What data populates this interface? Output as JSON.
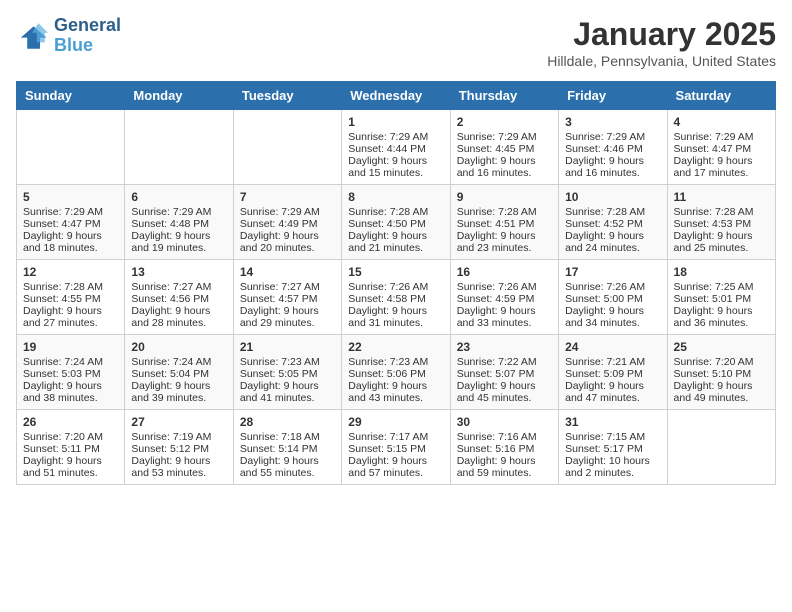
{
  "header": {
    "logo_line1": "General",
    "logo_line2": "Blue",
    "title": "January 2025",
    "subtitle": "Hilldale, Pennsylvania, United States"
  },
  "weekdays": [
    "Sunday",
    "Monday",
    "Tuesday",
    "Wednesday",
    "Thursday",
    "Friday",
    "Saturday"
  ],
  "weeks": [
    [
      {
        "day": "",
        "lines": []
      },
      {
        "day": "",
        "lines": []
      },
      {
        "day": "",
        "lines": []
      },
      {
        "day": "1",
        "lines": [
          "Sunrise: 7:29 AM",
          "Sunset: 4:44 PM",
          "Daylight: 9 hours",
          "and 15 minutes."
        ]
      },
      {
        "day": "2",
        "lines": [
          "Sunrise: 7:29 AM",
          "Sunset: 4:45 PM",
          "Daylight: 9 hours",
          "and 16 minutes."
        ]
      },
      {
        "day": "3",
        "lines": [
          "Sunrise: 7:29 AM",
          "Sunset: 4:46 PM",
          "Daylight: 9 hours",
          "and 16 minutes."
        ]
      },
      {
        "day": "4",
        "lines": [
          "Sunrise: 7:29 AM",
          "Sunset: 4:47 PM",
          "Daylight: 9 hours",
          "and 17 minutes."
        ]
      }
    ],
    [
      {
        "day": "5",
        "lines": [
          "Sunrise: 7:29 AM",
          "Sunset: 4:47 PM",
          "Daylight: 9 hours",
          "and 18 minutes."
        ]
      },
      {
        "day": "6",
        "lines": [
          "Sunrise: 7:29 AM",
          "Sunset: 4:48 PM",
          "Daylight: 9 hours",
          "and 19 minutes."
        ]
      },
      {
        "day": "7",
        "lines": [
          "Sunrise: 7:29 AM",
          "Sunset: 4:49 PM",
          "Daylight: 9 hours",
          "and 20 minutes."
        ]
      },
      {
        "day": "8",
        "lines": [
          "Sunrise: 7:28 AM",
          "Sunset: 4:50 PM",
          "Daylight: 9 hours",
          "and 21 minutes."
        ]
      },
      {
        "day": "9",
        "lines": [
          "Sunrise: 7:28 AM",
          "Sunset: 4:51 PM",
          "Daylight: 9 hours",
          "and 23 minutes."
        ]
      },
      {
        "day": "10",
        "lines": [
          "Sunrise: 7:28 AM",
          "Sunset: 4:52 PM",
          "Daylight: 9 hours",
          "and 24 minutes."
        ]
      },
      {
        "day": "11",
        "lines": [
          "Sunrise: 7:28 AM",
          "Sunset: 4:53 PM",
          "Daylight: 9 hours",
          "and 25 minutes."
        ]
      }
    ],
    [
      {
        "day": "12",
        "lines": [
          "Sunrise: 7:28 AM",
          "Sunset: 4:55 PM",
          "Daylight: 9 hours",
          "and 27 minutes."
        ]
      },
      {
        "day": "13",
        "lines": [
          "Sunrise: 7:27 AM",
          "Sunset: 4:56 PM",
          "Daylight: 9 hours",
          "and 28 minutes."
        ]
      },
      {
        "day": "14",
        "lines": [
          "Sunrise: 7:27 AM",
          "Sunset: 4:57 PM",
          "Daylight: 9 hours",
          "and 29 minutes."
        ]
      },
      {
        "day": "15",
        "lines": [
          "Sunrise: 7:26 AM",
          "Sunset: 4:58 PM",
          "Daylight: 9 hours",
          "and 31 minutes."
        ]
      },
      {
        "day": "16",
        "lines": [
          "Sunrise: 7:26 AM",
          "Sunset: 4:59 PM",
          "Daylight: 9 hours",
          "and 33 minutes."
        ]
      },
      {
        "day": "17",
        "lines": [
          "Sunrise: 7:26 AM",
          "Sunset: 5:00 PM",
          "Daylight: 9 hours",
          "and 34 minutes."
        ]
      },
      {
        "day": "18",
        "lines": [
          "Sunrise: 7:25 AM",
          "Sunset: 5:01 PM",
          "Daylight: 9 hours",
          "and 36 minutes."
        ]
      }
    ],
    [
      {
        "day": "19",
        "lines": [
          "Sunrise: 7:24 AM",
          "Sunset: 5:03 PM",
          "Daylight: 9 hours",
          "and 38 minutes."
        ]
      },
      {
        "day": "20",
        "lines": [
          "Sunrise: 7:24 AM",
          "Sunset: 5:04 PM",
          "Daylight: 9 hours",
          "and 39 minutes."
        ]
      },
      {
        "day": "21",
        "lines": [
          "Sunrise: 7:23 AM",
          "Sunset: 5:05 PM",
          "Daylight: 9 hours",
          "and 41 minutes."
        ]
      },
      {
        "day": "22",
        "lines": [
          "Sunrise: 7:23 AM",
          "Sunset: 5:06 PM",
          "Daylight: 9 hours",
          "and 43 minutes."
        ]
      },
      {
        "day": "23",
        "lines": [
          "Sunrise: 7:22 AM",
          "Sunset: 5:07 PM",
          "Daylight: 9 hours",
          "and 45 minutes."
        ]
      },
      {
        "day": "24",
        "lines": [
          "Sunrise: 7:21 AM",
          "Sunset: 5:09 PM",
          "Daylight: 9 hours",
          "and 47 minutes."
        ]
      },
      {
        "day": "25",
        "lines": [
          "Sunrise: 7:20 AM",
          "Sunset: 5:10 PM",
          "Daylight: 9 hours",
          "and 49 minutes."
        ]
      }
    ],
    [
      {
        "day": "26",
        "lines": [
          "Sunrise: 7:20 AM",
          "Sunset: 5:11 PM",
          "Daylight: 9 hours",
          "and 51 minutes."
        ]
      },
      {
        "day": "27",
        "lines": [
          "Sunrise: 7:19 AM",
          "Sunset: 5:12 PM",
          "Daylight: 9 hours",
          "and 53 minutes."
        ]
      },
      {
        "day": "28",
        "lines": [
          "Sunrise: 7:18 AM",
          "Sunset: 5:14 PM",
          "Daylight: 9 hours",
          "and 55 minutes."
        ]
      },
      {
        "day": "29",
        "lines": [
          "Sunrise: 7:17 AM",
          "Sunset: 5:15 PM",
          "Daylight: 9 hours",
          "and 57 minutes."
        ]
      },
      {
        "day": "30",
        "lines": [
          "Sunrise: 7:16 AM",
          "Sunset: 5:16 PM",
          "Daylight: 9 hours",
          "and 59 minutes."
        ]
      },
      {
        "day": "31",
        "lines": [
          "Sunrise: 7:15 AM",
          "Sunset: 5:17 PM",
          "Daylight: 10 hours",
          "and 2 minutes."
        ]
      },
      {
        "day": "",
        "lines": []
      }
    ]
  ]
}
